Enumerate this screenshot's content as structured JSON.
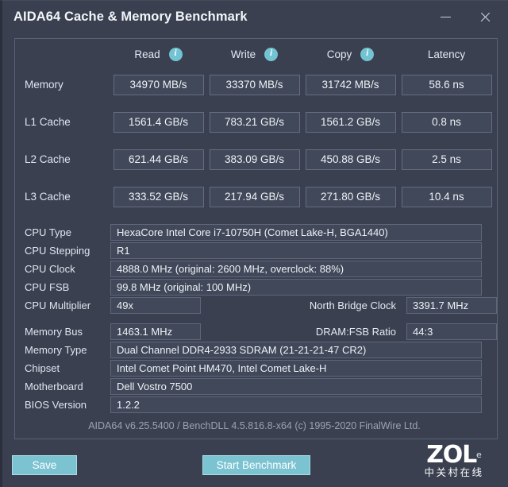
{
  "window": {
    "title": "AIDA64 Cache & Memory Benchmark",
    "minimize_label": "–",
    "close_label": "×",
    "accent_color": "#7cc3d2",
    "background_color": "#3a4050"
  },
  "benchmark": {
    "columns": [
      "Read",
      "Write",
      "Copy",
      "Latency"
    ],
    "info_icon_columns": [
      "Read",
      "Write",
      "Copy"
    ],
    "info_icon_glyph": "i",
    "rows": [
      {
        "label": "Memory",
        "read": "34970 MB/s",
        "write": "33370 MB/s",
        "copy": "31742 MB/s",
        "latency": "58.6 ns"
      },
      {
        "label": "L1 Cache",
        "read": "1561.4 GB/s",
        "write": "783.21 GB/s",
        "copy": "1561.2 GB/s",
        "latency": "0.8 ns"
      },
      {
        "label": "L2 Cache",
        "read": "621.44 GB/s",
        "write": "383.09 GB/s",
        "copy": "450.88 GB/s",
        "latency": "2.5 ns"
      },
      {
        "label": "L3 Cache",
        "read": "333.52 GB/s",
        "write": "217.94 GB/s",
        "copy": "271.80 GB/s",
        "latency": "10.4 ns"
      }
    ]
  },
  "cpu_info": {
    "cpu_type_label": "CPU Type",
    "cpu_type_value": "HexaCore Intel Core i7-10750H  (Comet Lake-H, BGA1440)",
    "cpu_stepping_label": "CPU Stepping",
    "cpu_stepping_value": "R1",
    "cpu_clock_label": "CPU Clock",
    "cpu_clock_value": "4888.0 MHz  (original: 2600 MHz, overclock: 88%)",
    "cpu_fsb_label": "CPU FSB",
    "cpu_fsb_value": "99.8 MHz  (original: 100 MHz)",
    "cpu_multiplier_label": "CPU Multiplier",
    "cpu_multiplier_value": "49x",
    "north_bridge_clock_label": "North Bridge Clock",
    "north_bridge_clock_value": "3391.7 MHz"
  },
  "memory_info": {
    "memory_bus_label": "Memory Bus",
    "memory_bus_value": "1463.1 MHz",
    "dram_fsb_ratio_label": "DRAM:FSB Ratio",
    "dram_fsb_ratio_value": "44:3",
    "memory_type_label": "Memory Type",
    "memory_type_value": "Dual Channel DDR4-2933 SDRAM  (21-21-21-47 CR2)",
    "chipset_label": "Chipset",
    "chipset_value": "Intel Comet Point HM470, Intel Comet Lake-H",
    "motherboard_label": "Motherboard",
    "motherboard_value": "Dell Vostro 7500",
    "bios_version_label": "BIOS Version",
    "bios_version_value": "1.2.2"
  },
  "credit": "AIDA64 v6.25.5400 / BenchDLL 4.5.816.8-x64  (c) 1995-2020 FinalWire Ltd.",
  "actions": {
    "save_label": "Save",
    "start_label": "Start Benchmark"
  },
  "watermark": {
    "brand": "ZOL",
    "superscript": "e",
    "subtitle": "中关村在线"
  }
}
